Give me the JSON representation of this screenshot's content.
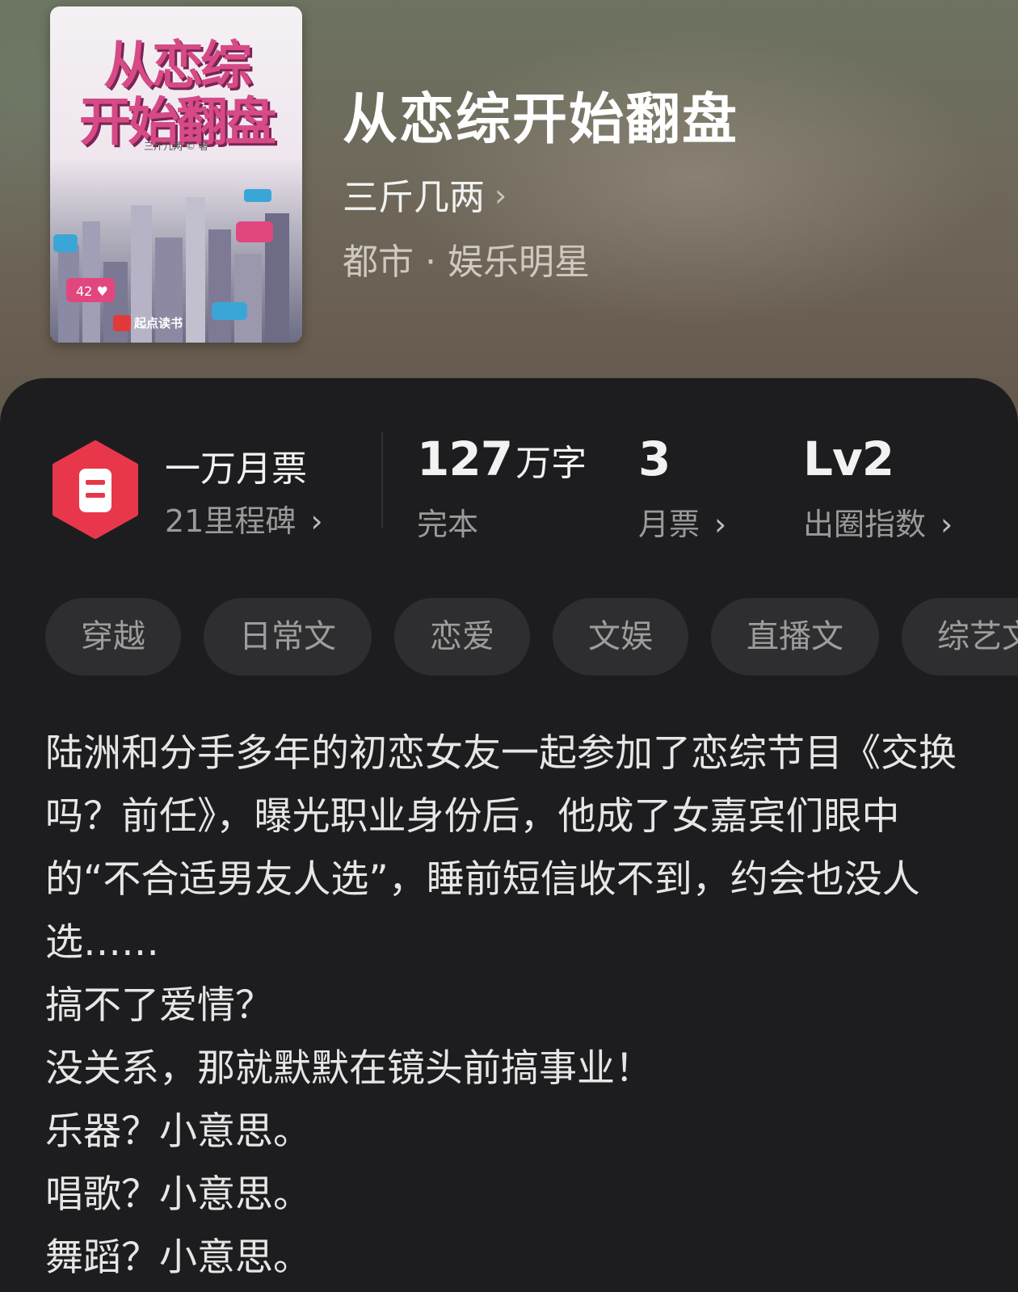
{
  "book": {
    "cover": {
      "title_line1": "从恋综",
      "title_line2": "开始翻盘",
      "author": "三斤几两 © 著",
      "brand": "起点读书"
    },
    "title": "从恋综开始翻盘",
    "author": "三斤几两",
    "genre": "都市 · 娱乐明星"
  },
  "stats": {
    "badge": {
      "title": "一万月票",
      "subtitle": "21里程碑"
    },
    "words": {
      "value": "127",
      "unit": "万字",
      "label": "完本"
    },
    "monthly_votes": {
      "value": "3",
      "label": "月票"
    },
    "breakout": {
      "value": "Lv2",
      "label": "出圈指数"
    }
  },
  "tags": [
    "穿越",
    "日常文",
    "恋爱",
    "文娱",
    "直播文",
    "综艺文"
  ],
  "description": [
    "陆洲和分手多年的初恋女友一起参加了恋综节目《交换吗？前任》，曝光职业身份后，他成了女嘉宾们眼中的“不合适男友人选”，睡前短信收不到，约会也没人选……",
    "搞不了爱情？",
    "没关系，那就默默在镜头前搞事业！",
    "乐器？小意思。",
    "唱歌？小意思。",
    "舞蹈？小意思。"
  ],
  "colors": {
    "background": "#1d1d1f",
    "tag_bg": "#2e2e30",
    "badge_red": "#e8374a"
  }
}
